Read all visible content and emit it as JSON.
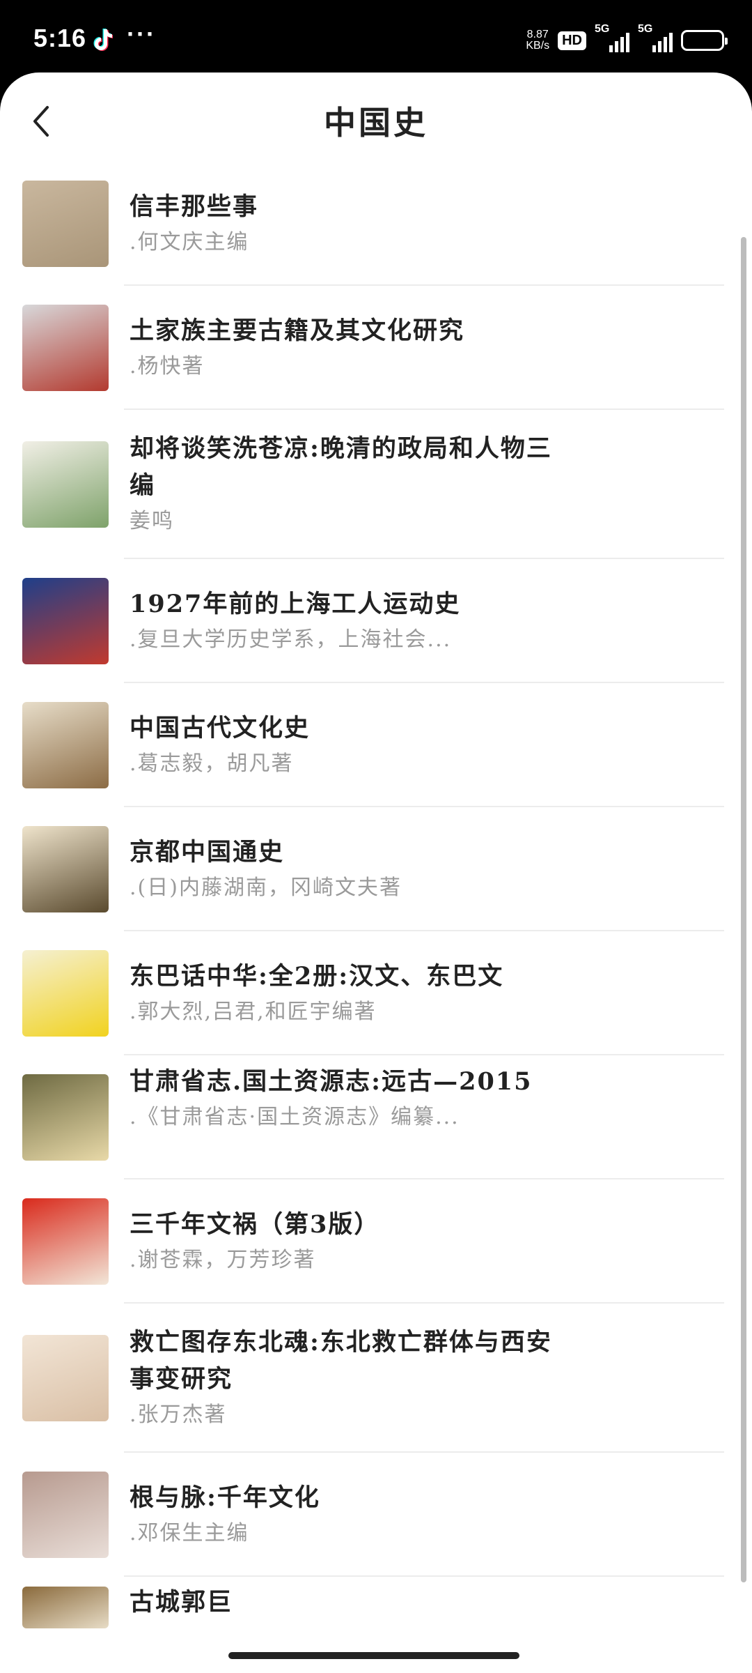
{
  "status_bar": {
    "time": "5:16",
    "net_speed_value": "8.87",
    "net_speed_unit": "KB/s",
    "hd_label": "HD",
    "sim1_label": "5G",
    "sim2_label": "5G",
    "more_label": "···",
    "app_icon": "tiktok-icon"
  },
  "header": {
    "title": "中国史",
    "back_icon": "chevron-left-icon"
  },
  "books": [
    {
      "title": "信丰那些事",
      "author": ".何文庆主编",
      "cover_colors": [
        "#c9b79e",
        "#a99578"
      ]
    },
    {
      "title": "土家族主要古籍及其文化研究",
      "author": ".杨快著",
      "cover_colors": [
        "#d8d8da",
        "#b33a2f"
      ]
    },
    {
      "title": "却将谈笑洗苍凉:晚清的政局和人物三编",
      "author": "姜鸣",
      "cover_colors": [
        "#f1efe6",
        "#7ea26a"
      ]
    },
    {
      "title": "1927年前的上海工人运动史",
      "author": ".复旦大学历史学系，上海社会...",
      "cover_colors": [
        "#1e3f8a",
        "#c23a2e"
      ]
    },
    {
      "title": "中国古代文化史",
      "author": ".葛志毅，胡凡著",
      "cover_colors": [
        "#e7ddc9",
        "#8c6c45"
      ]
    },
    {
      "title": "京都中国通史",
      "author": ".(日)内藤湖南，冈崎文夫著",
      "cover_colors": [
        "#efe4cc",
        "#5a4a2e"
      ]
    },
    {
      "title": "东巴话中华:全2册:汉文、东巴文",
      "author": ".郭大烈,吕君,和匠宇编著",
      "cover_colors": [
        "#f5f0d2",
        "#f1d21f"
      ]
    },
    {
      "title": "甘肃省志.国土资源志:远古—2015",
      "author": ".《甘肃省志·国土资源志》编纂...",
      "cover_colors": [
        "#6e6a42",
        "#e8d9a8"
      ]
    },
    {
      "title": "三千年文祸（第3版）",
      "author": ".谢苍霖，万芳珍著",
      "cover_colors": [
        "#d92a1c",
        "#f2e6d8"
      ]
    },
    {
      "title": "救亡图存东北魂:东北救亡群体与西安事变研究",
      "author": ".张万杰著",
      "cover_colors": [
        "#f2e5d6",
        "#d9bfa5"
      ]
    },
    {
      "title": "根与脉:千年文化",
      "author": ".邓保生主编",
      "cover_colors": [
        "#b79a8f",
        "#e9ded8"
      ]
    },
    {
      "title": "古城郭巨",
      "author": "",
      "cover_colors": [
        "#8a6a3c",
        "#e7dcc6"
      ]
    }
  ]
}
